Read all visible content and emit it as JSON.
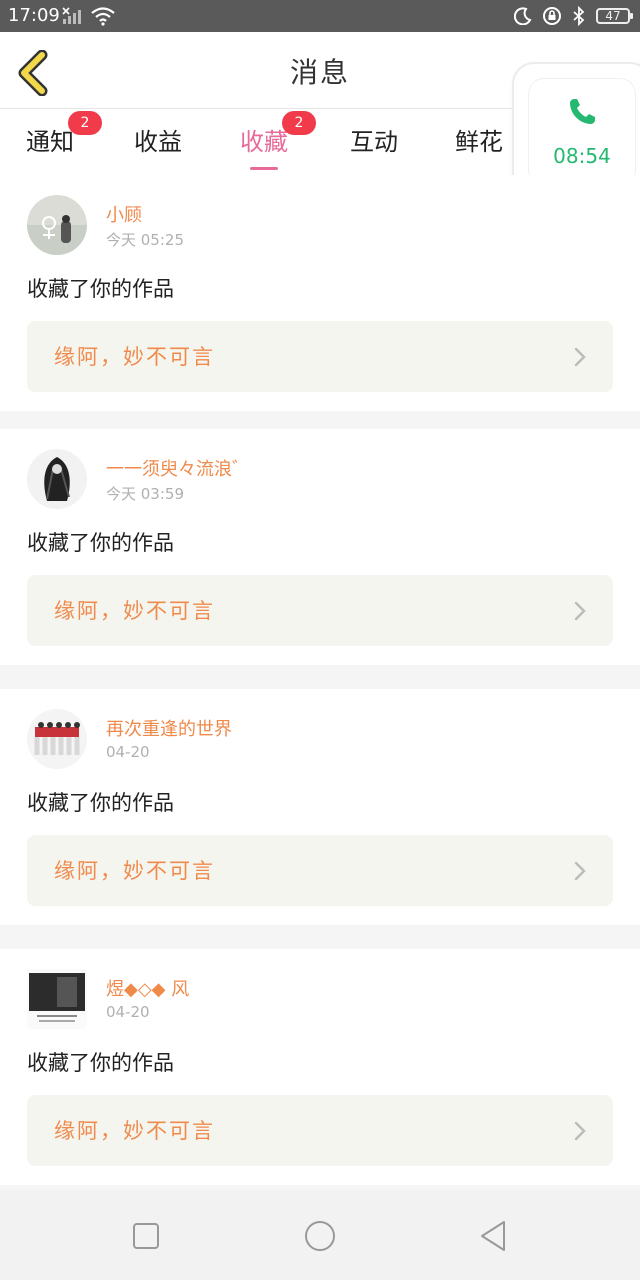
{
  "status_bar": {
    "time": "17:09",
    "battery": "47"
  },
  "header": {
    "title": "消息"
  },
  "tabs": [
    {
      "label": "通知",
      "badge": "2"
    },
    {
      "label": "收益",
      "badge": ""
    },
    {
      "label": "收藏",
      "badge": "2",
      "active": true
    },
    {
      "label": "互动",
      "badge": ""
    },
    {
      "label": "鲜花",
      "badge": ""
    }
  ],
  "call_float": {
    "timer": "08:54"
  },
  "items": [
    {
      "user": "小顾",
      "time": "今天 05:25",
      "action": "收藏了你的作品",
      "work": "缘阿，妙不可言"
    },
    {
      "user": "一一须臾々流浪゛",
      "time": "今天 03:59",
      "action": "收藏了你的作品",
      "work": "缘阿，妙不可言"
    },
    {
      "user": "再次重逢的世界",
      "time": "04-20",
      "action": "收藏了你的作品",
      "work": "缘阿，妙不可言"
    },
    {
      "user": "煜◆◇◆ 风",
      "time": "04-20",
      "action": "收藏了你的作品",
      "work": "缘阿，妙不可言"
    }
  ],
  "colors": {
    "accent_pink": "#e76a9a",
    "orange_text": "#f08a4b",
    "call_green": "#25b870",
    "badge_red": "#f13b4a"
  }
}
